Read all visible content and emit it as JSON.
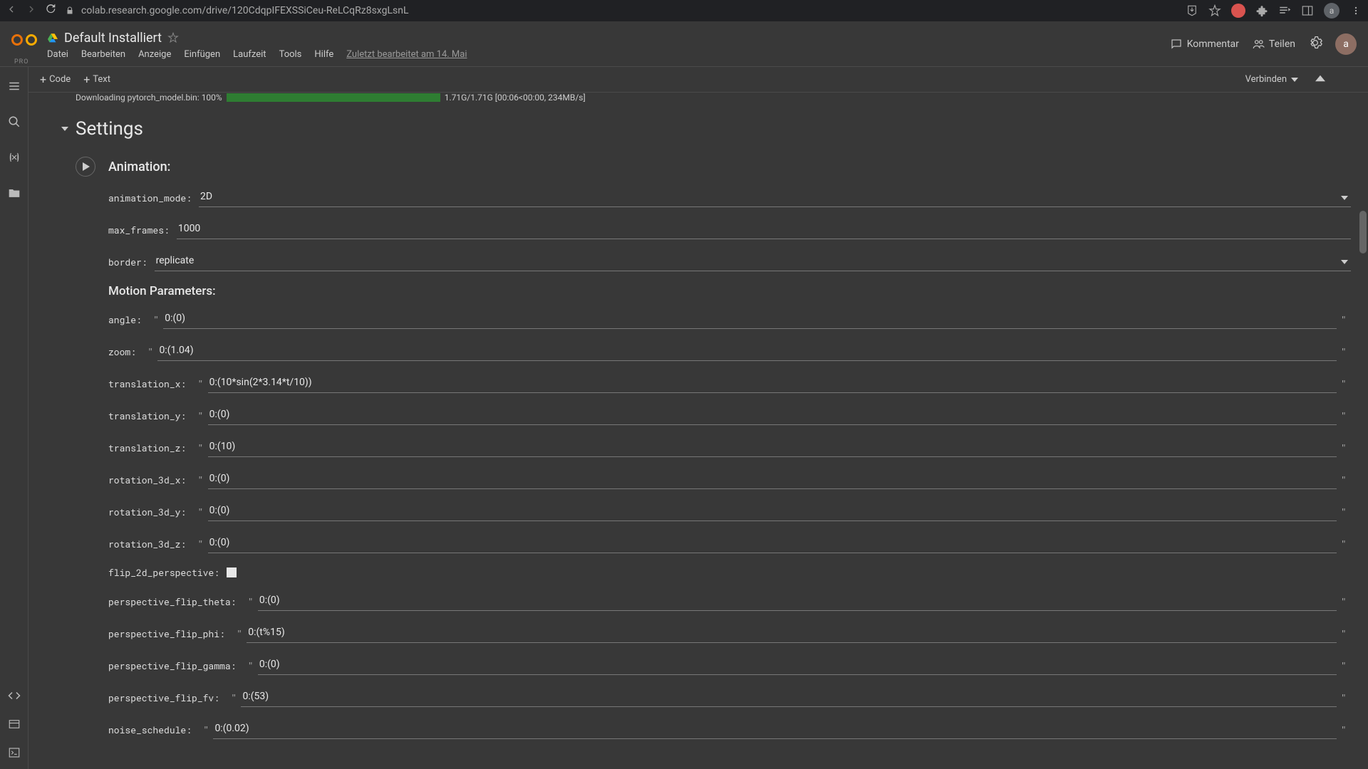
{
  "browser": {
    "url": "colab.research.google.com/drive/120CdqpIFEXSSiCeu-ReLCqRz8sxgLsnL",
    "avatar": "a"
  },
  "header": {
    "pro": "PRO",
    "title": "Default Installiert",
    "menu": {
      "file": "Datei",
      "edit": "Bearbeiten",
      "view": "Anzeige",
      "insert": "Einfügen",
      "runtime": "Laufzeit",
      "tools": "Tools",
      "help": "Hilfe",
      "last_edit": "Zuletzt bearbeitet am 14. Mai"
    },
    "comment": "Kommentar",
    "share": "Teilen",
    "avatar": "a"
  },
  "toolbar": {
    "code": "Code",
    "text": "Text",
    "connect": "Verbinden"
  },
  "download": {
    "label": "Downloading pytorch_model.bin: 100%",
    "stats": "1.71G/1.71G [00:06<00:00, 234MB/s]"
  },
  "section": {
    "title": "Settings"
  },
  "cell": {
    "heading": "Animation:",
    "sub_motion": "Motion Parameters:",
    "fields": {
      "animation_mode": {
        "label": "animation_mode",
        "value": "2D"
      },
      "max_frames": {
        "label": "max_frames",
        "value": "1000"
      },
      "border": {
        "label": "border",
        "value": "replicate"
      },
      "angle": {
        "label": "angle",
        "value": "0:(0)"
      },
      "zoom": {
        "label": "zoom",
        "value": "0:(1.04)"
      },
      "translation_x": {
        "label": "translation_x",
        "value": "0:(10*sin(2*3.14*t/10))"
      },
      "translation_y": {
        "label": "translation_y",
        "value": "0:(0)"
      },
      "translation_z": {
        "label": "translation_z",
        "value": "0:(10)"
      },
      "rotation_3d_x": {
        "label": "rotation_3d_x",
        "value": "0:(0)"
      },
      "rotation_3d_y": {
        "label": "rotation_3d_y",
        "value": "0:(0)"
      },
      "rotation_3d_z": {
        "label": "rotation_3d_z",
        "value": "0:(0)"
      },
      "flip_2d_perspective": {
        "label": "flip_2d_perspective"
      },
      "perspective_flip_theta": {
        "label": "perspective_flip_theta",
        "value": "0:(0)"
      },
      "perspective_flip_phi": {
        "label": "perspective_flip_phi",
        "value": "0:(t%15)"
      },
      "perspective_flip_gamma": {
        "label": "perspective_flip_gamma",
        "value": "0:(0)"
      },
      "perspective_flip_fv": {
        "label": "perspective_flip_fv",
        "value": "0:(53)"
      },
      "noise_schedule": {
        "label": "noise_schedule",
        "value": "0:(0.02)"
      }
    }
  }
}
